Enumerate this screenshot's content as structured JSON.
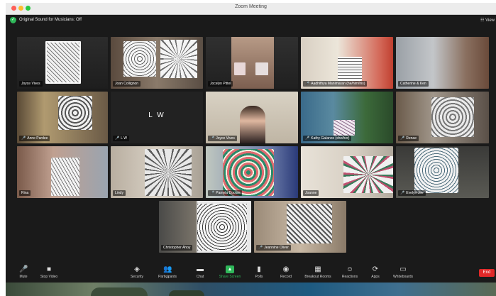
{
  "window": {
    "title": "Zoom Meeting"
  },
  "status": {
    "text": "Original Sound for Musicians: Off",
    "view_label": "View"
  },
  "participants": [
    {
      "name": "Joyce Vives",
      "muted": false
    },
    {
      "name": "Joan Collignon",
      "muted": false
    },
    {
      "name": "Jocelyn Pittel",
      "muted": false
    },
    {
      "name": "Aadhithya Manimaran (he/him/his)",
      "muted": true
    },
    {
      "name": "Catherine & Ken",
      "muted": false
    },
    {
      "name": "Anne Pardee",
      "muted": true
    },
    {
      "name": "L W",
      "muted": true,
      "initials": "L W"
    },
    {
      "name": "Joyce Vives",
      "muted": true
    },
    {
      "name": "Kathy Galanos (she/her)",
      "muted": true
    },
    {
      "name": "Renae",
      "muted": true
    },
    {
      "name": "Rina",
      "muted": false,
      "active_speaker": true
    },
    {
      "name": "Lindy",
      "muted": false
    },
    {
      "name": "Pamela Doolan",
      "muted": true
    },
    {
      "name": "Joanne",
      "muted": false
    },
    {
      "name": "Evelyn Jee",
      "muted": true
    },
    {
      "name": "Christopher Ahoy",
      "muted": false
    },
    {
      "name": "Jeannine Oliver",
      "muted": true
    }
  ],
  "toolbar": {
    "mute": "Mute",
    "stop_video": "Stop Video",
    "security": "Security",
    "participants": "Participants",
    "participants_count": "17",
    "chat": "Chat",
    "share_screen": "Share Screen",
    "polls": "Polls",
    "record": "Record",
    "breakout_rooms": "Breakout Rooms",
    "reactions": "Reactions",
    "apps": "Apps",
    "whiteboards": "Whiteboards",
    "end": "End"
  },
  "colors": {
    "accent": "#2fb85a",
    "end": "#e02828",
    "active_speaker": "#3ad04b",
    "muted_mic": "#ff4444"
  }
}
